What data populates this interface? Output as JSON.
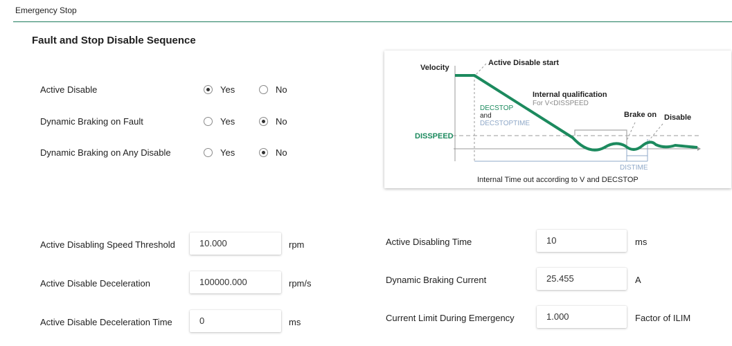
{
  "group": {
    "title": "Emergency Stop"
  },
  "section": {
    "title": "Fault and Stop Disable Sequence"
  },
  "radio_rows": [
    {
      "label": "Active Disable",
      "yes": "Yes",
      "no": "No",
      "selected": "Yes"
    },
    {
      "label": "Dynamic Braking on Fault",
      "yes": "Yes",
      "no": "No",
      "selected": "No"
    },
    {
      "label": "Dynamic Braking on Any Disable",
      "yes": "Yes",
      "no": "No",
      "selected": "No"
    }
  ],
  "left_fields": [
    {
      "label": "Active Disabling Speed Threshold",
      "value": "10.000",
      "unit": "rpm"
    },
    {
      "label": "Active Disable Deceleration",
      "value": "100000.000",
      "unit": "rpm/s"
    },
    {
      "label": "Active Disable Deceleration Time",
      "value": "0",
      "unit": "ms"
    }
  ],
  "right_fields": [
    {
      "label": "Active Disabling Time",
      "value": "10",
      "unit": "ms"
    },
    {
      "label": "Dynamic Braking Current",
      "value": "25.455",
      "unit": "A"
    },
    {
      "label": "Current Limit During Emergency",
      "value": "1.000",
      "unit": "Factor of ILIM"
    }
  ],
  "diagram": {
    "velocity": "Velocity",
    "active_disable_start": "Active Disable start",
    "internal_qualification": "Internal qualification",
    "for_v": "For V<DISSPEED",
    "decstop": "DECSTOP",
    "and": "and",
    "decstoptime": "DECSTOPTIME",
    "disspeed": "DISSPEED",
    "brake_on": "Brake on",
    "disable": "Disable",
    "distime": "DISTIME",
    "timeout": "Internal Time out according to V and DECSTOP",
    "colors": {
      "green": "#1c8a5e",
      "blue_grey": "#8fa8c8",
      "dashed": "#9a9a9a"
    }
  }
}
